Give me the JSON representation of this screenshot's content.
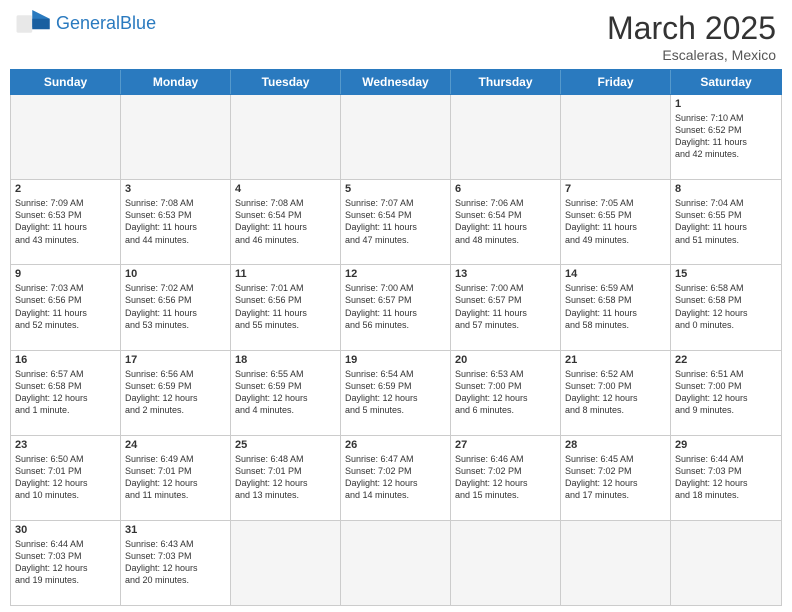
{
  "header": {
    "logo_general": "General",
    "logo_blue": "Blue",
    "month_title": "March 2025",
    "subtitle": "Escaleras, Mexico"
  },
  "weekdays": [
    "Sunday",
    "Monday",
    "Tuesday",
    "Wednesday",
    "Thursday",
    "Friday",
    "Saturday"
  ],
  "rows": [
    [
      {
        "day": "",
        "info": "",
        "empty": true
      },
      {
        "day": "",
        "info": "",
        "empty": true
      },
      {
        "day": "",
        "info": "",
        "empty": true
      },
      {
        "day": "",
        "info": "",
        "empty": true
      },
      {
        "day": "",
        "info": "",
        "empty": true
      },
      {
        "day": "",
        "info": "",
        "empty": true
      },
      {
        "day": "1",
        "info": "Sunrise: 7:10 AM\nSunset: 6:52 PM\nDaylight: 11 hours\nand 42 minutes.",
        "empty": false
      }
    ],
    [
      {
        "day": "2",
        "info": "Sunrise: 7:09 AM\nSunset: 6:53 PM\nDaylight: 11 hours\nand 43 minutes.",
        "empty": false
      },
      {
        "day": "3",
        "info": "Sunrise: 7:08 AM\nSunset: 6:53 PM\nDaylight: 11 hours\nand 44 minutes.",
        "empty": false
      },
      {
        "day": "4",
        "info": "Sunrise: 7:08 AM\nSunset: 6:54 PM\nDaylight: 11 hours\nand 46 minutes.",
        "empty": false
      },
      {
        "day": "5",
        "info": "Sunrise: 7:07 AM\nSunset: 6:54 PM\nDaylight: 11 hours\nand 47 minutes.",
        "empty": false
      },
      {
        "day": "6",
        "info": "Sunrise: 7:06 AM\nSunset: 6:54 PM\nDaylight: 11 hours\nand 48 minutes.",
        "empty": false
      },
      {
        "day": "7",
        "info": "Sunrise: 7:05 AM\nSunset: 6:55 PM\nDaylight: 11 hours\nand 49 minutes.",
        "empty": false
      },
      {
        "day": "8",
        "info": "Sunrise: 7:04 AM\nSunset: 6:55 PM\nDaylight: 11 hours\nand 51 minutes.",
        "empty": false
      }
    ],
    [
      {
        "day": "9",
        "info": "Sunrise: 7:03 AM\nSunset: 6:56 PM\nDaylight: 11 hours\nand 52 minutes.",
        "empty": false
      },
      {
        "day": "10",
        "info": "Sunrise: 7:02 AM\nSunset: 6:56 PM\nDaylight: 11 hours\nand 53 minutes.",
        "empty": false
      },
      {
        "day": "11",
        "info": "Sunrise: 7:01 AM\nSunset: 6:56 PM\nDaylight: 11 hours\nand 55 minutes.",
        "empty": false
      },
      {
        "day": "12",
        "info": "Sunrise: 7:00 AM\nSunset: 6:57 PM\nDaylight: 11 hours\nand 56 minutes.",
        "empty": false
      },
      {
        "day": "13",
        "info": "Sunrise: 7:00 AM\nSunset: 6:57 PM\nDaylight: 11 hours\nand 57 minutes.",
        "empty": false
      },
      {
        "day": "14",
        "info": "Sunrise: 6:59 AM\nSunset: 6:58 PM\nDaylight: 11 hours\nand 58 minutes.",
        "empty": false
      },
      {
        "day": "15",
        "info": "Sunrise: 6:58 AM\nSunset: 6:58 PM\nDaylight: 12 hours\nand 0 minutes.",
        "empty": false
      }
    ],
    [
      {
        "day": "16",
        "info": "Sunrise: 6:57 AM\nSunset: 6:58 PM\nDaylight: 12 hours\nand 1 minute.",
        "empty": false
      },
      {
        "day": "17",
        "info": "Sunrise: 6:56 AM\nSunset: 6:59 PM\nDaylight: 12 hours\nand 2 minutes.",
        "empty": false
      },
      {
        "day": "18",
        "info": "Sunrise: 6:55 AM\nSunset: 6:59 PM\nDaylight: 12 hours\nand 4 minutes.",
        "empty": false
      },
      {
        "day": "19",
        "info": "Sunrise: 6:54 AM\nSunset: 6:59 PM\nDaylight: 12 hours\nand 5 minutes.",
        "empty": false
      },
      {
        "day": "20",
        "info": "Sunrise: 6:53 AM\nSunset: 7:00 PM\nDaylight: 12 hours\nand 6 minutes.",
        "empty": false
      },
      {
        "day": "21",
        "info": "Sunrise: 6:52 AM\nSunset: 7:00 PM\nDaylight: 12 hours\nand 8 minutes.",
        "empty": false
      },
      {
        "day": "22",
        "info": "Sunrise: 6:51 AM\nSunset: 7:00 PM\nDaylight: 12 hours\nand 9 minutes.",
        "empty": false
      }
    ],
    [
      {
        "day": "23",
        "info": "Sunrise: 6:50 AM\nSunset: 7:01 PM\nDaylight: 12 hours\nand 10 minutes.",
        "empty": false
      },
      {
        "day": "24",
        "info": "Sunrise: 6:49 AM\nSunset: 7:01 PM\nDaylight: 12 hours\nand 11 minutes.",
        "empty": false
      },
      {
        "day": "25",
        "info": "Sunrise: 6:48 AM\nSunset: 7:01 PM\nDaylight: 12 hours\nand 13 minutes.",
        "empty": false
      },
      {
        "day": "26",
        "info": "Sunrise: 6:47 AM\nSunset: 7:02 PM\nDaylight: 12 hours\nand 14 minutes.",
        "empty": false
      },
      {
        "day": "27",
        "info": "Sunrise: 6:46 AM\nSunset: 7:02 PM\nDaylight: 12 hours\nand 15 minutes.",
        "empty": false
      },
      {
        "day": "28",
        "info": "Sunrise: 6:45 AM\nSunset: 7:02 PM\nDaylight: 12 hours\nand 17 minutes.",
        "empty": false
      },
      {
        "day": "29",
        "info": "Sunrise: 6:44 AM\nSunset: 7:03 PM\nDaylight: 12 hours\nand 18 minutes.",
        "empty": false
      }
    ],
    [
      {
        "day": "30",
        "info": "Sunrise: 6:44 AM\nSunset: 7:03 PM\nDaylight: 12 hours\nand 19 minutes.",
        "empty": false
      },
      {
        "day": "31",
        "info": "Sunrise: 6:43 AM\nSunset: 7:03 PM\nDaylight: 12 hours\nand 20 minutes.",
        "empty": false
      },
      {
        "day": "",
        "info": "",
        "empty": true
      },
      {
        "day": "",
        "info": "",
        "empty": true
      },
      {
        "day": "",
        "info": "",
        "empty": true
      },
      {
        "day": "",
        "info": "",
        "empty": true
      },
      {
        "day": "",
        "info": "",
        "empty": true
      }
    ]
  ]
}
